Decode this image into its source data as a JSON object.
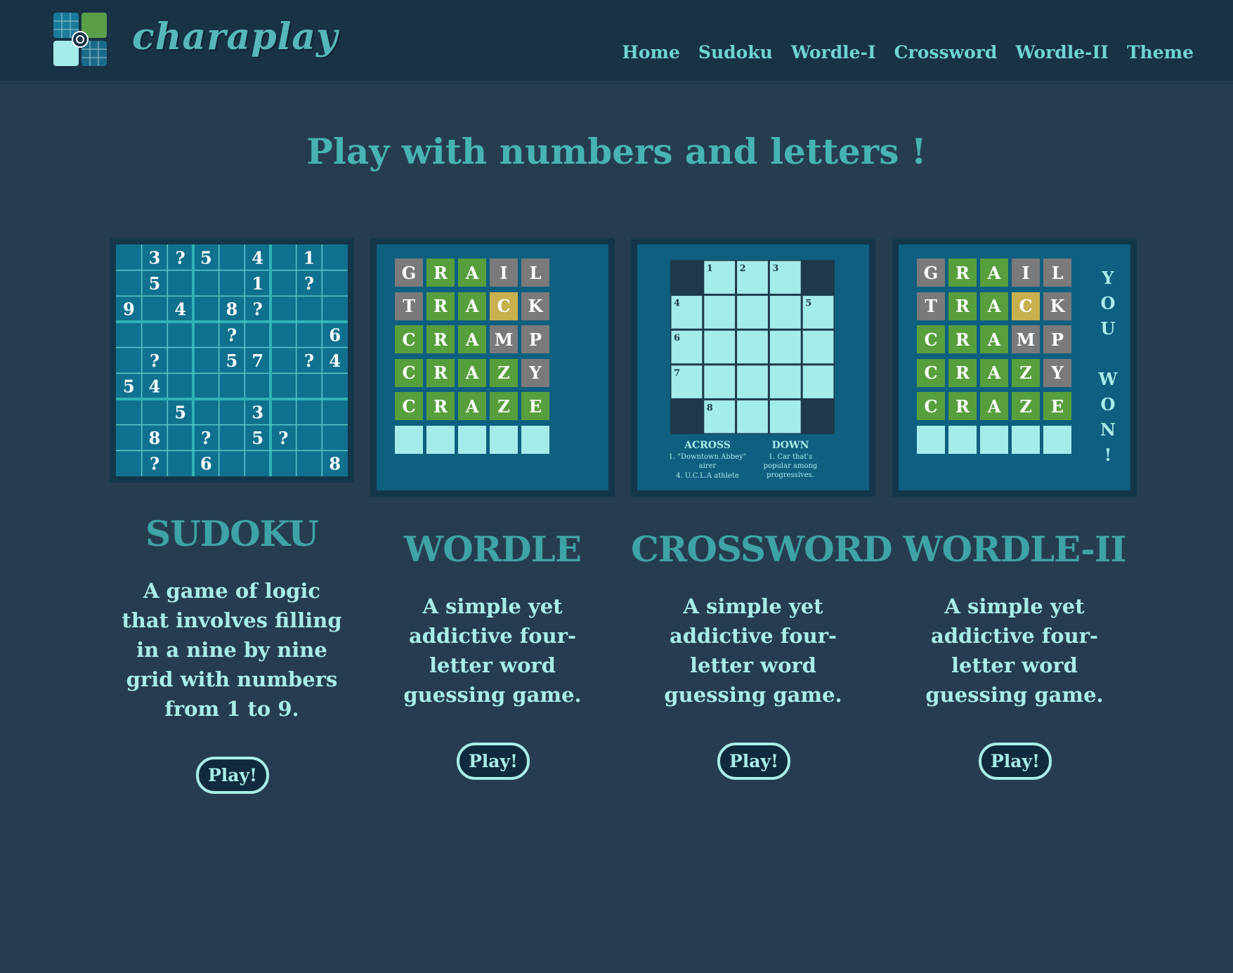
{
  "header": {
    "brand": "charaplay",
    "nav": [
      "Home",
      "Sudoku",
      "Wordle-I",
      "Crossword",
      "Wordle-II",
      "Theme"
    ]
  },
  "headline": "Play with numbers and letters !",
  "cards": [
    {
      "title": "SUDOKU",
      "description": "A game of logic that involves filling in a nine by nine grid with numbers from 1 to 9.",
      "button": "Play!"
    },
    {
      "title": "WORDLE",
      "description": "A simple yet addictive four-letter word guessing game.",
      "button": "Play!"
    },
    {
      "title": "CROSSWORD",
      "description": "A simple yet addictive four-letter word guessing game.",
      "button": "Play!"
    },
    {
      "title": "WORDLE-II",
      "description": "A simple yet addictive four-letter word guessing game.",
      "button": "Play!"
    }
  ],
  "sudoku_cells": [
    [
      "",
      "3",
      "?",
      "5",
      "",
      "4",
      "",
      "1",
      ""
    ],
    [
      "",
      "5",
      "",
      "",
      "",
      "1",
      "",
      "?",
      ""
    ],
    [
      "9",
      "",
      "4",
      "",
      "8",
      "?",
      "",
      "",
      ""
    ],
    [
      "",
      "",
      "",
      "",
      "?",
      "",
      "",
      "",
      "6"
    ],
    [
      "",
      "?",
      "",
      "",
      "5",
      "7",
      "",
      "?",
      "4"
    ],
    [
      "5",
      "4",
      "",
      "",
      "",
      "",
      "",
      "",
      ""
    ],
    [
      "",
      "",
      "5",
      "",
      "",
      "3",
      "",
      "",
      ""
    ],
    [
      "",
      "8",
      "",
      "?",
      "",
      "5",
      "?",
      "",
      ""
    ],
    [
      "",
      "?",
      "",
      "6",
      "",
      "",
      "",
      "",
      "8"
    ]
  ],
  "wordle_rows": [
    [
      [
        "G",
        "gray"
      ],
      [
        "R",
        "green"
      ],
      [
        "A",
        "green"
      ],
      [
        "I",
        "gray"
      ],
      [
        "L",
        "gray"
      ]
    ],
    [
      [
        "T",
        "gray"
      ],
      [
        "R",
        "green"
      ],
      [
        "A",
        "green"
      ],
      [
        "C",
        "yellow"
      ],
      [
        "K",
        "gray"
      ]
    ],
    [
      [
        "C",
        "green"
      ],
      [
        "R",
        "green"
      ],
      [
        "A",
        "green"
      ],
      [
        "M",
        "gray"
      ],
      [
        "P",
        "gray"
      ]
    ],
    [
      [
        "C",
        "green"
      ],
      [
        "R",
        "green"
      ],
      [
        "A",
        "green"
      ],
      [
        "Z",
        "green"
      ],
      [
        "Y",
        "gray"
      ]
    ],
    [
      [
        "C",
        "green"
      ],
      [
        "R",
        "green"
      ],
      [
        "A",
        "green"
      ],
      [
        "Z",
        "green"
      ],
      [
        "E",
        "green"
      ]
    ],
    [
      [
        "",
        "empty"
      ],
      [
        "",
        "empty"
      ],
      [
        "",
        "empty"
      ],
      [
        "",
        "empty"
      ],
      [
        "",
        "empty"
      ]
    ]
  ],
  "won_text": [
    "Y",
    "O",
    "U",
    "",
    "W",
    "O",
    "N",
    "!"
  ],
  "crossword": {
    "numbers": [
      "1",
      "2",
      "3",
      "4",
      "5",
      "6",
      "7",
      "8"
    ],
    "across_heading": "ACROSS",
    "down_heading": "DOWN",
    "across_clues": [
      "1. \"Downtown Abbey\" airer",
      "4. U.C.L.A athlete"
    ],
    "down_clues": [
      "1. Car that's popular among progressives."
    ]
  },
  "colors": {
    "background": "#263d51",
    "topbar": "#183246",
    "accent": "#47b3b3",
    "text": "#a8ece8",
    "tile_green": "#579f3d",
    "tile_gray": "#7a7a7a",
    "tile_yellow": "#c8b04f",
    "tile_empty": "#a4ece9",
    "crossword_cell": "#a4ece9"
  }
}
